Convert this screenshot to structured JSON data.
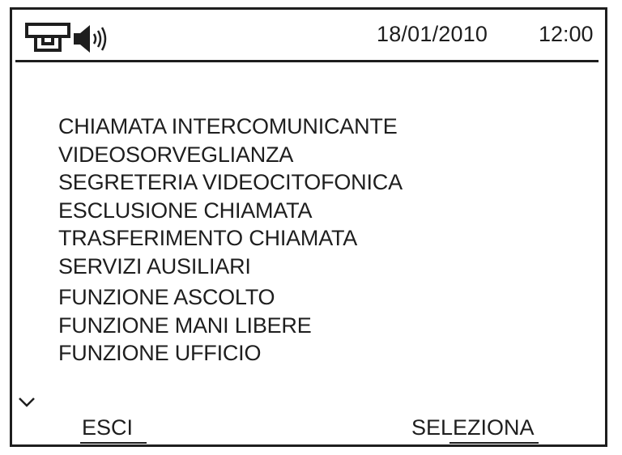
{
  "status_bar": {
    "icons": [
      "intercom-handset-icon",
      "speaker-volume-icon"
    ],
    "date": "18/01/2010",
    "time": "12:00"
  },
  "menu": {
    "items": [
      {
        "label": "CHIAMATA INTERCOMUNICANTE"
      },
      {
        "label": "VIDEOSORVEGLIANZA"
      },
      {
        "label": "SEGRETERIA VIDEOCITOFONICA"
      },
      {
        "label": "ESCLUSIONE CHIAMATA"
      },
      {
        "label": "TRASFERIMENTO CHIAMATA"
      },
      {
        "label": "SERVIZI AUSILIARI"
      },
      {
        "label": "FUNZIONE ASCOLTO"
      },
      {
        "label": "FUNZIONE MANI LIBERE"
      },
      {
        "label": "FUNZIONE UFFICIO"
      }
    ],
    "scroll_icon": "chevron-down-icon"
  },
  "softkeys": {
    "exit_label": "ESCI",
    "select_label": "SELEZIONA"
  },
  "colors": {
    "ink": "#1e1e1e",
    "background": "#ffffff"
  }
}
